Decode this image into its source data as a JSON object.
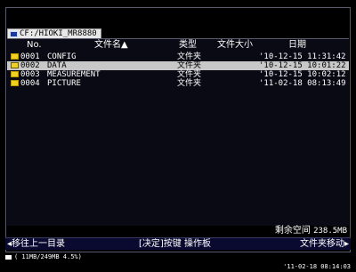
{
  "path": "CF:/HIOKI_MR8880",
  "columns": {
    "no": "No.",
    "name": "文件名▲",
    "type": "类型",
    "size": "文件大小",
    "date": "日期"
  },
  "files": [
    {
      "num": "0001",
      "name": "CONFIG",
      "type": "文件夹",
      "date": "'10-12-15 11:31:42",
      "selected": false
    },
    {
      "num": "0002",
      "name": "DATA",
      "type": "文件夹",
      "date": "'10-12-15 10:01:22",
      "selected": true
    },
    {
      "num": "0003",
      "name": "MEASUREMENT",
      "type": "文件夹",
      "date": "'10-12-15 10:02:12",
      "selected": false
    },
    {
      "num": "0004",
      "name": "PICTURE",
      "type": "文件夹",
      "date": "'11-02-18 08:13:49",
      "selected": false
    }
  ],
  "free_space": {
    "label": "剩余空间",
    "value": "238.5MB"
  },
  "softkeys": {
    "left": "◂移往上一目录",
    "center": "[决定]按键 操作板",
    "right": "文件夹移动▸"
  },
  "status": {
    "text": "( 11MB/249MB  4.5%)"
  },
  "clock": "'11-02-18 08:14:03",
  "colors": {
    "selected_row": "#c8c8c8",
    "folder": "#f0d020",
    "softkey_bar": "#0a0a30"
  },
  "icons": {
    "card": "cf-card-icon",
    "folder": "folder-icon",
    "status": "storage-icon"
  }
}
